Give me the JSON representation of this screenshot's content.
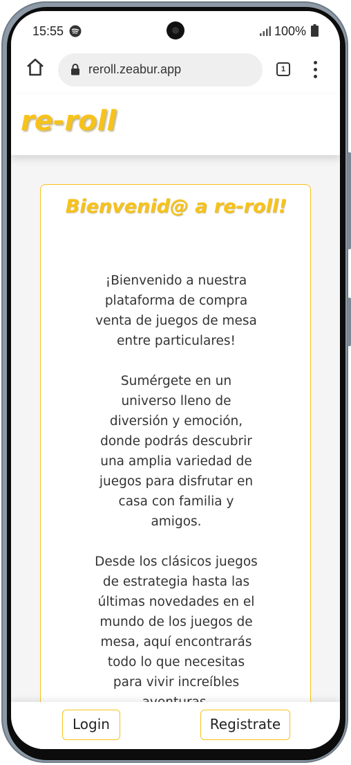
{
  "status": {
    "time": "15:55",
    "battery": "100%",
    "notification_icon": "spotify-icon",
    "signal_icon": "signal-icon",
    "battery_icon": "battery-icon"
  },
  "browser": {
    "url": "reroll.zeabur.app",
    "tab_count": "1",
    "home_icon": "home-icon",
    "lock_icon": "lock-icon",
    "menu_icon": "more-vert-icon"
  },
  "site": {
    "logo": "re-roll",
    "brand_color": "#f7c21a"
  },
  "welcome": {
    "title": "Bienvenid@ a re-roll!",
    "paragraphs": [
      "¡Bienvenido a nuestra plataforma de compra venta de juegos de mesa entre particulares!",
      "Sumérgete en un universo lleno de diversión y emoción, donde podrás descubrir una amplia variedad de juegos para disfrutar en casa con familia y amigos.",
      "Desde los clásicos juegos de estrategia hasta las últimas novedades en el mundo de los juegos de mesa, aquí encontrarás todo lo que necesitas para vivir increíbles aventuras."
    ]
  },
  "actions": {
    "login": "Login",
    "register": "Registrate"
  }
}
